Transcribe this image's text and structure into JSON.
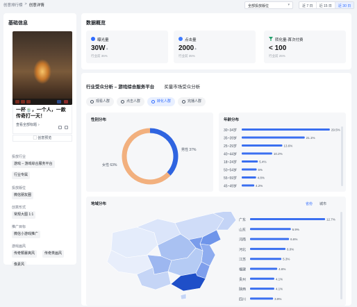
{
  "breadcrumb": {
    "items": [
      "创意排行榜",
      "创意详情"
    ],
    "separator": ">"
  },
  "filters": {
    "position_select": "全部投放版位",
    "ranges": [
      "近 7 日",
      "近 15 日",
      "近 30 日"
    ],
    "active_range": 2
  },
  "basic_info": {
    "title": "基础信息",
    "creative_title": "一杯🍵，一个人，一款传奇打一天！",
    "view_full_title": "查看全部标题",
    "preview_label": "创意预览",
    "fields": [
      {
        "label": "投放行业",
        "tags": [
          "游戏 – 游戏综合服务平台",
          "行业专属"
        ]
      },
      {
        "label": "投放版位",
        "tags": [
          "微信朋友圈"
        ]
      },
      {
        "label": "创意形式",
        "tags": [
          "常规大图 1:1"
        ]
      },
      {
        "label": "推广目标",
        "tags": [
          "微信小游戏推广"
        ]
      },
      {
        "label": "游戏画风",
        "tags": [
          "传奇類暴爽风",
          "传奇类画风",
          "像素风"
        ]
      }
    ]
  },
  "overview": {
    "title": "数据概览",
    "kpis": [
      {
        "name": "曝光量",
        "value": "30W",
        "suffix": "+",
        "sub": "行业前 35%",
        "color": "#2f6bff",
        "icon": "eye-icon"
      },
      {
        "name": "点击量",
        "value": "2000",
        "suffix": "+",
        "sub": "行业前 35%",
        "color": "#3d7bff",
        "icon": "thumb-icon"
      },
      {
        "name": "转化量-首次付费",
        "value": "< 100",
        "suffix": "",
        "sub": "行业前 25%",
        "color": "#22a06b",
        "icon": "funnel-icon"
      }
    ]
  },
  "analysis": {
    "tabs": [
      "行业受众分析 – 游戏综合服务平台",
      "买量市场受众分析"
    ],
    "active_tab": 0,
    "subtabs": [
      {
        "label": "观看人群",
        "icon": "eye-icon"
      },
      {
        "label": "点击人群",
        "icon": "thumb-icon"
      },
      {
        "label": "转化人群",
        "icon": "funnel-icon"
      },
      {
        "label": "完播人群",
        "icon": "play-icon"
      }
    ],
    "active_subtab": 2,
    "gender": {
      "title": "性别分布",
      "male_label": "男性 37%",
      "female_label": "女性 63%"
    },
    "age": {
      "title": "年龄分布"
    },
    "region": {
      "title": "地域分布",
      "toggle": [
        "省份",
        "城市"
      ],
      "active_toggle": 0
    }
  },
  "chart_data": [
    {
      "type": "pie",
      "title": "性别分布",
      "labels": [
        "男性",
        "女性"
      ],
      "values": [
        37,
        63
      ],
      "colors": [
        "#2f64e0",
        "#f2b07e"
      ]
    },
    {
      "type": "bar",
      "title": "年龄分布",
      "orientation": "horizontal",
      "categories": [
        "30~34岁",
        "35~39岁",
        "25~29岁",
        "40~44岁",
        "18~24岁",
        "50~54岁",
        "55~59岁",
        "45~49岁"
      ],
      "values": [
        29.5,
        21.1,
        13.6,
        10.2,
        5.4,
        5.0,
        4.8,
        4.2
      ],
      "value_labels": [
        "29.5%",
        "21.1%",
        "13.6%",
        "10.2%",
        "5.4%",
        "5%",
        "4.8%",
        "4.2%"
      ],
      "xlim": [
        0,
        30
      ],
      "color": "#3a6ff0"
    },
    {
      "type": "bar",
      "title": "地域分布",
      "orientation": "horizontal",
      "categories": [
        "广东",
        "山东",
        "河南",
        "河北",
        "江苏",
        "福建",
        "贵州",
        "陕西",
        "四川"
      ],
      "values": [
        12.7,
        6.9,
        6.6,
        6.0,
        5.3,
        4.6,
        4.1,
        4.1,
        3.9
      ],
      "value_labels": [
        "12.7%",
        "6.9%",
        "6.6%",
        "6.0%",
        "5.3%",
        "4.6%",
        "4.1%",
        "4.1%",
        "3.9%"
      ],
      "xlim": [
        0,
        12.7
      ],
      "color": "#3a6ff0"
    }
  ]
}
